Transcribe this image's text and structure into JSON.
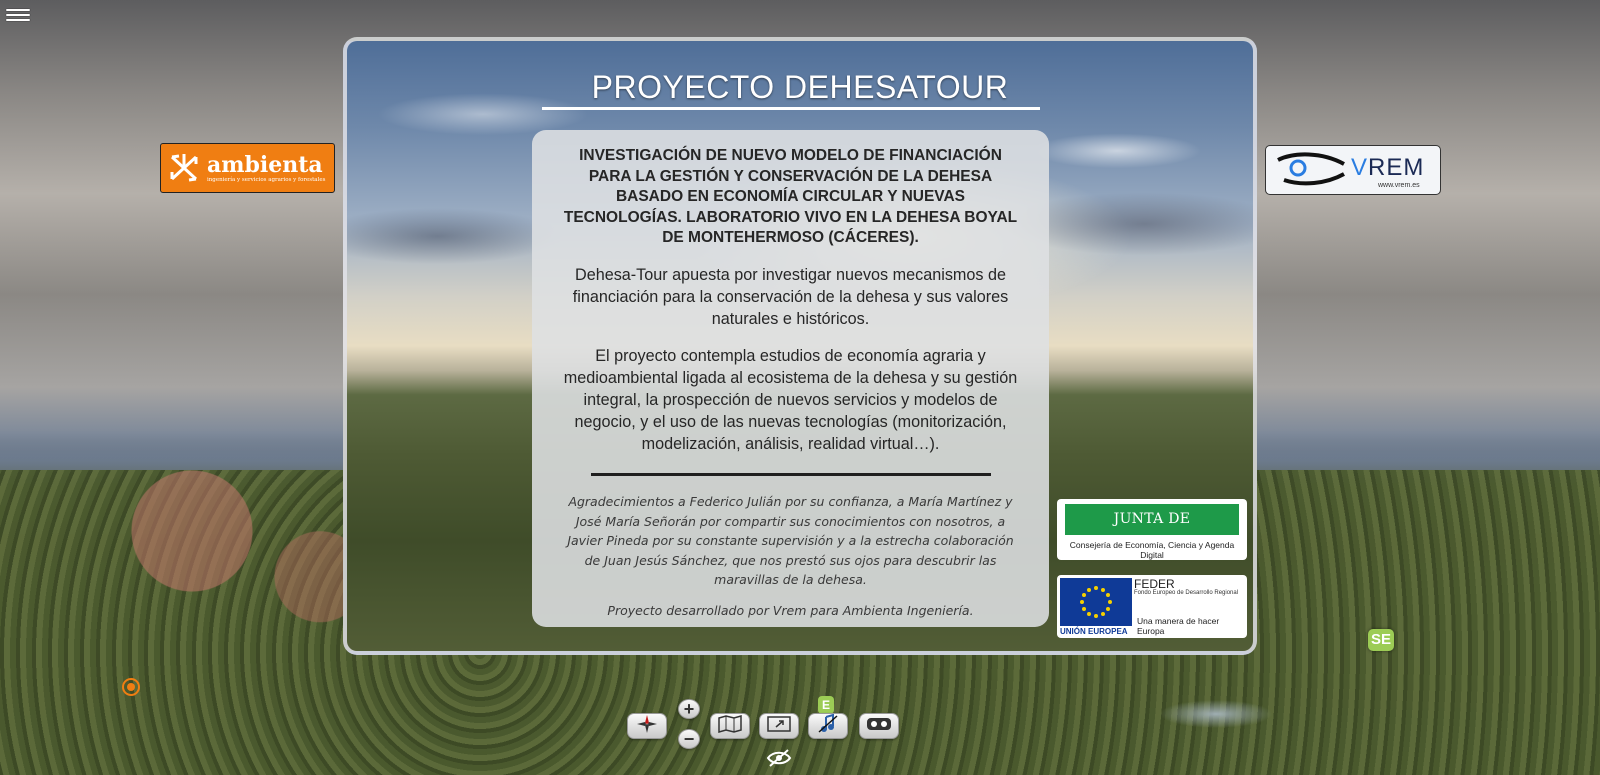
{
  "menu": {
    "icon": "hamburger-menu-icon"
  },
  "logos": {
    "ambienta": {
      "name": "ambienta",
      "subtitle": "ingeniería y servicios agrarios y forestales",
      "color": "#f07e12"
    },
    "vrem": {
      "name_v": "V",
      "name_rest": "REM",
      "url": "www.vrem.es"
    },
    "junta": {
      "name": "JUNTA DE EXTREMADURA",
      "subtitle": "Consejería de Economía, Ciencia y Agenda Digital",
      "color": "#1e9a49"
    },
    "feder": {
      "title": "FEDER",
      "subtitle": "Fondo Europeo de Desarrollo Regional",
      "slogan": "Una manera de hacer Europa",
      "eu_label": "UNIÓN EUROPEA"
    }
  },
  "panel": {
    "title": "PROYECTO DEHESATOUR",
    "heading": "INVESTIGACIÓN DE NUEVO MODELO DE FINANCIACIÓN PARA LA GESTIÓN Y CONSERVACIÓN DE LA DEHESA BASADO EN ECONOMÍA CIRCULAR Y NUEVAS TECNOLOGÍAS. LABORATORIO VIVO EN LA DEHESA BOYAL DE MONTEHERMOSO (CÁCERES).",
    "paragraph1": "Dehesa-Tour  apuesta por investigar nuevos mecanismos de financiación para la conservación de la dehesa y sus valores naturales e históricos.",
    "paragraph2": "El proyecto contempla estudios de economía agraria y medioambiental ligada al ecosistema de la dehesa y su gestión integral, la prospección de nuevos servicios y modelos de negocio, y el uso de las nuevas tecnologías (monitorización, modelización, análisis, realidad virtual…).",
    "acknowledgements": "Agradecimientos a Federico Julián por su confianza, a María Martínez y José María Señorán por compartir sus conocimientos con nosotros, a Javier Pineda por su constante supervisión y a la estrecha colaboración de Juan Jesús Sánchez, que nos prestó sus ojos para descubrir las maravillas de la dehesa.",
    "credit": "Proyecto desarrollado por Vrem para Ambienta Ingeniería."
  },
  "hotspots": {
    "se_label": "SE",
    "e_label": "E"
  },
  "controls": {
    "zoom_in": "+",
    "zoom_out": "−",
    "icons": [
      "compass-icon",
      "map-icon",
      "fullscreen-icon",
      "sound-off-icon",
      "vr-glasses-icon",
      "hide-eye-icon"
    ]
  }
}
